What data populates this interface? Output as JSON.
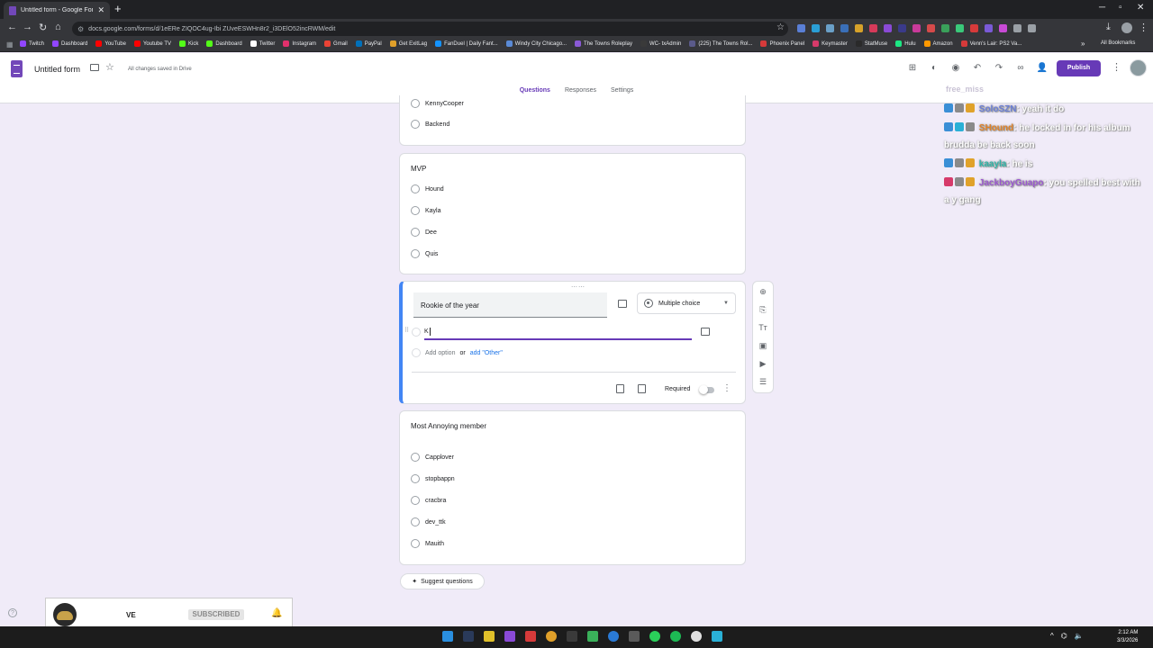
{
  "browser": {
    "tab_title": "Untitled form - Google Forms",
    "url": "docs.google.com/forms/d/1eERe ZIQOC4ug-Ibi ZUveESWHn8r2_i3DElO52incRWM/edit"
  },
  "bookmarks": {
    "items": [
      "Twitch",
      "Dashboard",
      "YouTube",
      "Youtube TV",
      "Kick",
      "Dashboard",
      "Twitter",
      "Instagram",
      "Gmail",
      "PayPal",
      "Get ExitLag",
      "FanDuel | Daily Fant...",
      "Windy City Chicago...",
      "The Towns Roleplay",
      "WC- txAdmin",
      "(225) The Towns Rol...",
      "Phoenix Panel",
      "Keymaster",
      "StatMuse",
      "Hulu",
      "Amazon",
      "Venn's Lair: PS2 Va..."
    ],
    "all_bookmarks": "All Bookmarks"
  },
  "header": {
    "form_title": "Untitled form",
    "saved_status": "All changes saved in Drive",
    "publish_label": "Publish",
    "tabs": [
      "Questions",
      "Responses",
      "Settings"
    ]
  },
  "cards": {
    "top": {
      "options": [
        "KennyCooper",
        "Backend"
      ]
    },
    "mvp": {
      "title": "MVP",
      "options": [
        "Hound",
        "Kayla",
        "Dee",
        "Quis"
      ]
    },
    "rookie": {
      "title": "Rookie of the year",
      "question_type": "Multiple choice",
      "option_value": "K",
      "add_option": "Add option",
      "or": "or",
      "add_other": "add \"Other\"",
      "required_label": "Required"
    },
    "annoying": {
      "title": "Most Annoying member",
      "options": [
        "Capplover",
        "stopbappn",
        "cracbra",
        "dev_ttk",
        "Mauith"
      ]
    }
  },
  "suggest_label": "Suggest questions",
  "chat": {
    "faded_line": "free_miss",
    "messages": [
      {
        "user": "SoloSZN",
        "color": "#6b7fd6",
        "text": ": yeah it do"
      },
      {
        "user": "SHound",
        "color": "#e0822a",
        "text": ": he locked in for his album brudda be back soon"
      },
      {
        "user": "kaayla",
        "color": "#2fb5a8",
        "text": ": he is"
      },
      {
        "user": "JackboyGuapo",
        "color": "#9b59d0",
        "text": ": you spelled best with a y gang"
      }
    ]
  },
  "subscribe_widget": {
    "name": "VE",
    "button": "SUBSCRIBED"
  },
  "taskbar": {
    "time": "2:12 AM",
    "date": "3/3/2026"
  }
}
